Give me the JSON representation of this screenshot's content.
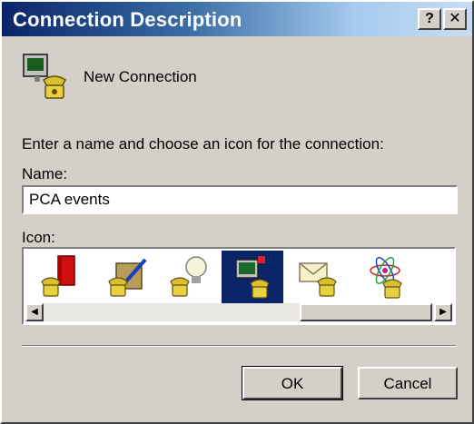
{
  "window": {
    "title": "Connection Description",
    "help_glyph": "?",
    "close_glyph": "✕"
  },
  "header": {
    "label": "New Connection",
    "icon": "phone-connection-icon"
  },
  "prompt": "Enter a name and choose an icon for the connection:",
  "name": {
    "label": "Name:",
    "value": "PCA events"
  },
  "icons": {
    "label": "Icon:",
    "items": [
      {
        "name": "phone-red-book-icon"
      },
      {
        "name": "phone-tools-icon"
      },
      {
        "name": "phone-lightbulb-icon"
      },
      {
        "name": "phone-computer-icon",
        "selected": true
      },
      {
        "name": "phone-envelope-icon"
      },
      {
        "name": "phone-atom-icon"
      }
    ],
    "scroll_left_glyph": "◀",
    "scroll_right_glyph": "▶"
  },
  "buttons": {
    "ok_label": "OK",
    "cancel_label": "Cancel"
  },
  "colors": {
    "titlebar_start": "#0a246a",
    "titlebar_end": "#c8dcf2",
    "face": "#d4d0c8",
    "selection": "#0a246a"
  }
}
